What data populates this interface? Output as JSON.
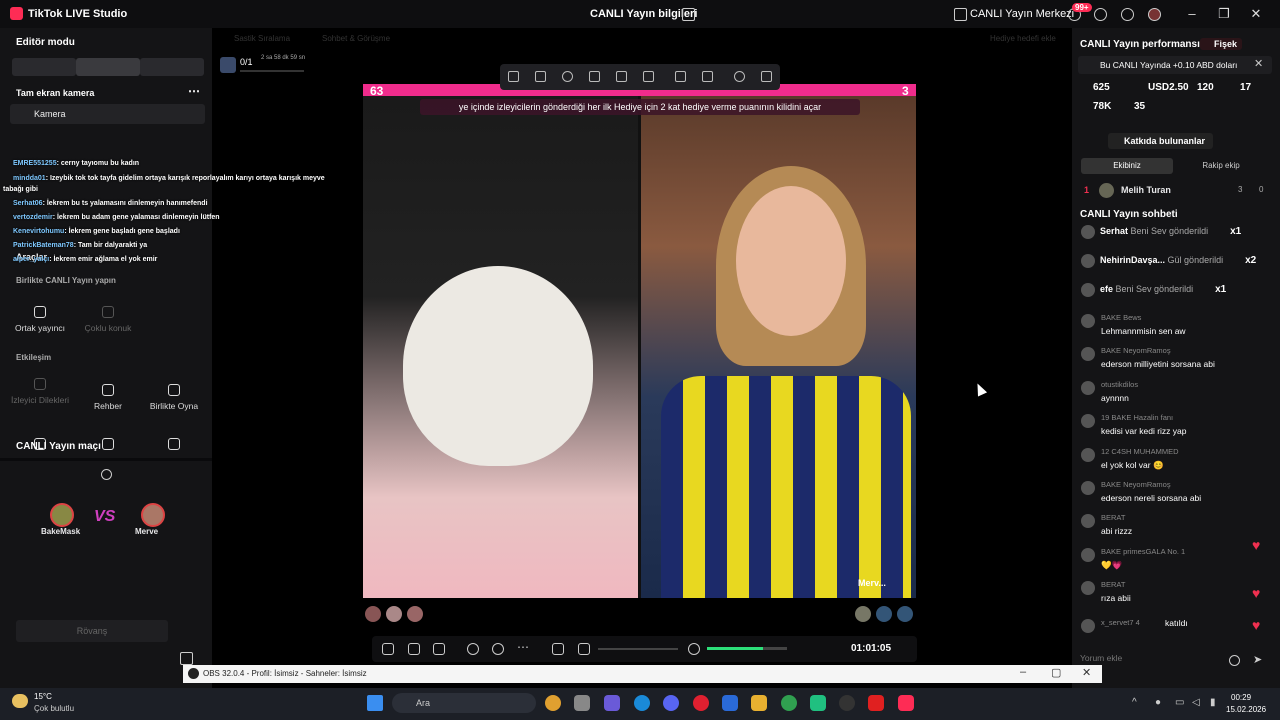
{
  "titlebar": {
    "app_title": "TikTok LIVE Studio",
    "window_title": "CANLI Yayın bilgileri",
    "live_center": "CANLI Yayın Merkezi",
    "notification_count": "99+"
  },
  "left": {
    "editor_mode": "Editör modu",
    "camera_mode": "Tam ekran kamera",
    "camera_item": "Kamera",
    "tools_header": "Araçlar",
    "collab_header": "Birlikte CANLI Yayın yapın",
    "collab_items": [
      "Ortak yayıncı",
      "Çoklu konuk"
    ],
    "interaction_header": "Etkileşim",
    "interaction_items": [
      "İzleyici Dilekleri",
      "Rehber",
      "Birlikte Oyna"
    ],
    "match_title": "CANLI Yayın maçı",
    "match_left": "BakeMask",
    "match_vs": "VS",
    "match_right": "Merve",
    "rematch": "Rövanş"
  },
  "chat_overlay": [
    {
      "user": "EMRE551255",
      "text": ": cerny tayıomu bu kadın"
    },
    {
      "user": "mindda01",
      "text": ": Izeybik tok tok tayfa gidelim ortaya karışık reporlayalım karıyı ortaya karışık meyve"
    },
    {
      "user": "",
      "text": "tabağı gibi"
    },
    {
      "user": "Serhat06",
      "text": ": İekrem bu ts yalamasını dinlemeyin hanımefendi"
    },
    {
      "user": "vertozdemir",
      "text": ": İekrem bu adam gene yalaması dinlemeyin lütfen"
    },
    {
      "user": "Kenevirtohumu",
      "text": ": İekrem gene başladı gene başladı"
    },
    {
      "user": "PatrickBateman78",
      "text": ": Tam bir dalyarakti ya"
    },
    {
      "user": "alper_yalçı",
      "text": ": İekrem emir ağlama el yok emir"
    }
  ],
  "stage": {
    "goal": "0/1",
    "goal_time": "2 sa 58 dk 59 sn",
    "faint_tabs": [
      "Sastik Sıralama",
      "Sohbet & Görüşme",
      "Hediye hedefi ekle"
    ],
    "score_left": "63",
    "score_right": "3",
    "banner": "ye içinde izleyicilerin gönderdiği her ilk Hediye için 2 kat hediye verme puanının kilidini açar",
    "guest_name": "Merv...",
    "timer": "01:01:05",
    "volume_level": 0.7
  },
  "right": {
    "perf_title": "CANLI Yayın performansı",
    "fisek": "Fişek",
    "promo": "Bu CANLI Yayında +0.10 ABD doları",
    "stats": [
      "625",
      "USD2.50",
      "120",
      "17",
      "78K",
      "35"
    ],
    "contributors": "Katkıda bulunanlar",
    "tab_team": "Ekibiniz",
    "tab_rival": "Rakip ekip",
    "rank1_num": "1",
    "rank1_name": "Melih Turan",
    "rank1_likes": "3",
    "rank1_zero": "0",
    "chat_title": "CANLI Yayın sohbeti",
    "gifts": [
      {
        "user": "Serhat",
        "text": "Beni Sev gönderildi",
        "count": "x1"
      },
      {
        "user": "NehirinDavşa...",
        "text": "Gül gönderildi",
        "count": "x2"
      },
      {
        "user": "efe",
        "text": "Beni Sev gönderildi",
        "count": "x1"
      }
    ],
    "comments": [
      {
        "user": "BAKE Bews",
        "text": "Lehmannmisin sen aw"
      },
      {
        "user": "BAKE NeyomRamoş",
        "text": "ederson milliyetini sorsana abi"
      },
      {
        "user": "otustikdilos",
        "text": "aynnnn"
      },
      {
        "user": "19 BAKE Hazalin fanı",
        "text": "kedisi var kedi rizz yap"
      },
      {
        "user": "12 C4SH MUHAMMED",
        "text": "el yok kol var 😊"
      },
      {
        "user": "BAKE NeyomRamoş",
        "text": "ederson nereli sorsana abi"
      },
      {
        "user": "BERAT",
        "text": "abi rizzz"
      },
      {
        "user": "BAKE primesGALA No. 1",
        "text": "💛💗"
      },
      {
        "user": "BERAT",
        "text": "rıza abii"
      },
      {
        "user": "x_servet7 4",
        "text": "katıldı"
      }
    ],
    "comment_placeholder": "Yorum ekle"
  },
  "obs": {
    "title": "OBS 32.0.4 - Profil: İsimsiz - Sahneler: İsimsiz"
  },
  "taskbar": {
    "temp": "15°C",
    "weather": "Çok bulutlu",
    "search": "Ara",
    "time": "00:29",
    "date": "15.02.2026"
  }
}
